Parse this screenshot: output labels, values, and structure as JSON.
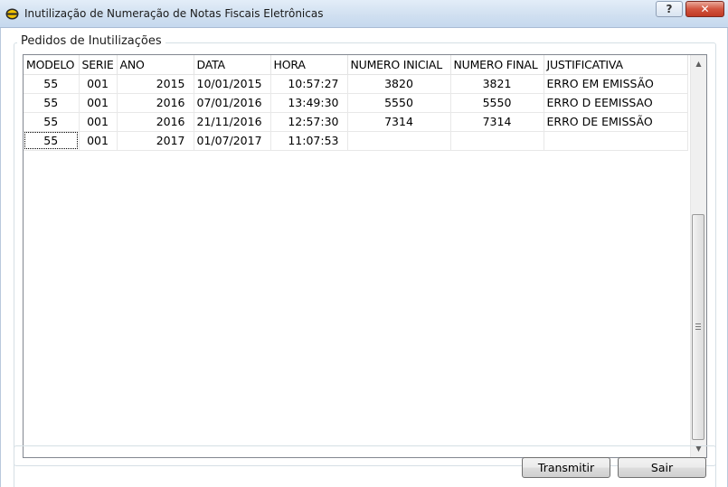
{
  "window": {
    "title": "Inutilização de Numeração de Notas Fiscais Eletrônicas",
    "help_label": "?",
    "close_label": "✕"
  },
  "group": {
    "legend": "Pedidos de Inutilizações"
  },
  "grid": {
    "columns": [
      "MODELO",
      "SERIE",
      "ANO",
      "DATA",
      "HORA",
      "NUMERO INICIAL",
      "NUMERO FINAL",
      "JUSTIFICATIVA"
    ],
    "rows": [
      [
        "55",
        "001",
        "2015",
        "10/01/2015",
        "10:57:27",
        "3820",
        "3821",
        "ERRO EM EMISSÃO"
      ],
      [
        "55",
        "001",
        "2016",
        "07/01/2016",
        "13:49:30",
        "5550",
        "5550",
        "ERRO D EEMISSAO"
      ],
      [
        "55",
        "001",
        "2016",
        "21/11/2016",
        "12:57:30",
        "7314",
        "7314",
        "ERRO DE EMISSÃO"
      ],
      [
        "55",
        "001",
        "2017",
        "01/07/2017",
        "11:07:53",
        "",
        "",
        ""
      ]
    ]
  },
  "scrollbar": {
    "up_icon": "▲",
    "down_icon": "▼"
  },
  "buttons": {
    "transmit": "Transmitir",
    "exit": "Sair"
  },
  "colors": {
    "titlebar": "#cfdff0",
    "close_button": "#c94a36",
    "app_icon_accent": "#f2c200"
  }
}
